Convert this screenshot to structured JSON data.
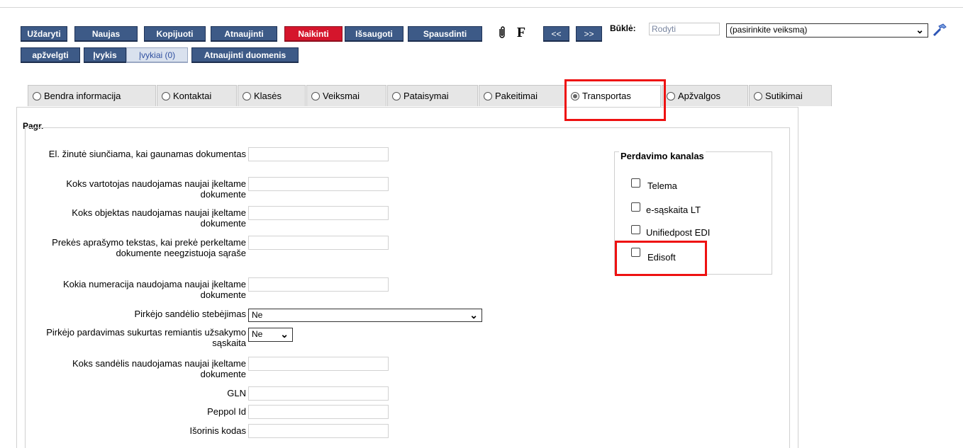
{
  "toolbar": {
    "close": "Uždaryti",
    "new": "Naujas",
    "copy": "Kopijuoti",
    "refresh": "Atnaujinti",
    "delete": "Naikinti",
    "save": "Išsaugoti",
    "print": "Spausdinti",
    "f_label": "F",
    "prev": "<<",
    "next": ">>",
    "status_label": "Būklė:",
    "status_value": "Rodyti",
    "action_select": "(pasirinkite veiksmą)",
    "review": "apžvelgti",
    "event": "Įvykis",
    "events_count": "Įvykiai (0)",
    "refresh_data": "Atnaujinti duomenis"
  },
  "tabs": [
    {
      "label": "Bendra informacija",
      "active": false
    },
    {
      "label": "Kontaktai",
      "active": false
    },
    {
      "label": "Klasės",
      "active": false
    },
    {
      "label": "Veiksmai",
      "active": false
    },
    {
      "label": "Pataisymai",
      "active": false
    },
    {
      "label": "Pakeitimai",
      "active": false
    },
    {
      "label": "Transportas",
      "active": true
    },
    {
      "label": "Apžvalgos",
      "active": false
    },
    {
      "label": "Sutikimai",
      "active": false
    }
  ],
  "section_title": "Pagr.",
  "fields": {
    "email_sent": {
      "label": "El. žinutė siunčiama, kai gaunamas dokumentas",
      "value": ""
    },
    "user_new": {
      "label": "Koks vartotojas naudojamas naujai įkeltame dokumente",
      "value": ""
    },
    "object_new": {
      "label": "Koks objektas naudojamas naujai įkeltame dokumente",
      "value": ""
    },
    "item_desc": {
      "label": "Prekės aprašymo tekstas, kai prekė perkeltame dokumente neegzistuoja sąraše",
      "value": ""
    },
    "numbering_new": {
      "label": "Kokia numeracija naudojama naujai įkeltame dokumente",
      "value": ""
    },
    "buyer_stock": {
      "label": "Pirkėjo sandėlio stebėjimas",
      "value": "Ne"
    },
    "buyer_sale": {
      "label": "Pirkėjo pardavimas sukurtas remiantis užsakymo sąskaita",
      "value": "Ne"
    },
    "warehouse_new": {
      "label": "Koks sandėlis naudojamas naujai įkeltame dokumente",
      "value": ""
    },
    "gln": {
      "label": "GLN",
      "value": ""
    },
    "peppol": {
      "label": "Peppol Id",
      "value": ""
    },
    "external_code": {
      "label": "Išorinis kodas",
      "value": ""
    }
  },
  "channels": {
    "title": "Perdavimo kanalas",
    "items": [
      {
        "label": "Telema",
        "checked": false
      },
      {
        "label": "e-sąskaita LT",
        "checked": false
      },
      {
        "label": "Unifiedpost EDI",
        "checked": false
      },
      {
        "label": "Edisoft",
        "checked": false
      }
    ]
  },
  "colors": {
    "button": "#3d5a87",
    "delete_button": "#d5152c",
    "highlight": "#ee1111"
  }
}
